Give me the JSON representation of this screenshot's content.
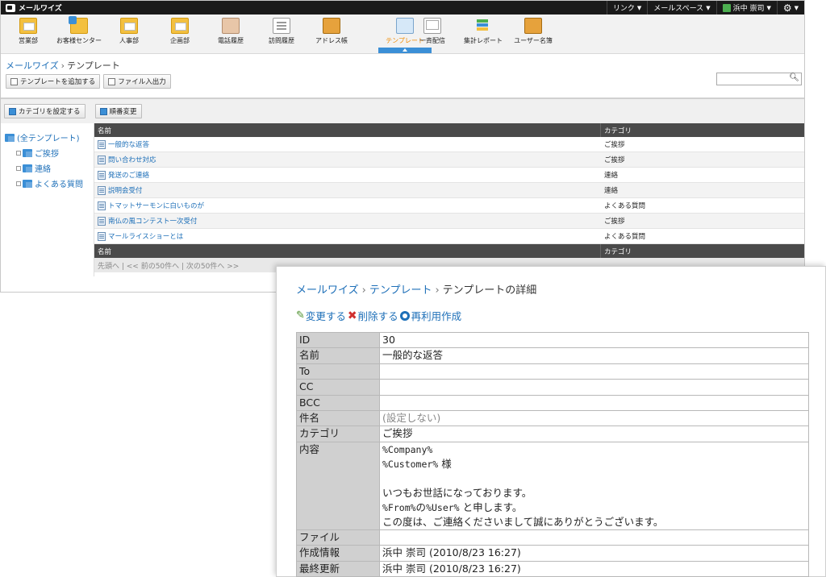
{
  "topbar": {
    "app_name": "メールワイズ",
    "menu": [
      {
        "label": "リンク"
      },
      {
        "label": "メールスペース"
      },
      {
        "label": "浜中 崇司"
      }
    ]
  },
  "apps": [
    {
      "label": "営業部",
      "icon": "folder-icon"
    },
    {
      "label": "お客様センター",
      "icon": "folder-blue-icon"
    },
    {
      "label": "人事部",
      "icon": "folder-icon"
    },
    {
      "label": "企画部",
      "icon": "folder-icon"
    },
    {
      "label": "電話履歴",
      "icon": "phone-log-icon"
    },
    {
      "label": "訪問履歴",
      "icon": "memo-icon"
    },
    {
      "label": "アドレス帳",
      "icon": "address-book-icon"
    },
    {
      "label": "テンプレート",
      "icon": "template-icon"
    },
    {
      "label": "一斉配信",
      "icon": "broadcast-icon"
    },
    {
      "label": "集計レポート",
      "icon": "report-icon"
    },
    {
      "label": "ユーザー名簿",
      "icon": "user-list-icon"
    }
  ],
  "breadcrumb": {
    "root": "メールワイズ",
    "current": "テンプレート"
  },
  "toolbar": {
    "add_template": "テンプレートを追加する",
    "file_io": "ファイル入出力",
    "search_placeholder": ""
  },
  "toolbar2": {
    "set_category": "カテゴリを設定する",
    "reorder": "順番変更"
  },
  "tree": {
    "root": "(全テンプレート)",
    "children": [
      "ご挨拶",
      "連絡",
      "よくある質問"
    ]
  },
  "grid": {
    "header": {
      "name": "名前",
      "category": "カテゴリ"
    },
    "rows": [
      {
        "name": "一般的な返答",
        "category": "ご挨拶"
      },
      {
        "name": "問い合わせ対応",
        "category": "ご挨拶"
      },
      {
        "name": "発送のご連絡",
        "category": "連絡"
      },
      {
        "name": "説明会受付",
        "category": "連絡"
      },
      {
        "name": "トマットサーモンに白いものが",
        "category": "よくある質問"
      },
      {
        "name": "南仏の風コンテスト一次受付",
        "category": "ご挨拶"
      },
      {
        "name": "マールライスショーとは",
        "category": "よくある質問"
      }
    ],
    "pager": "先頭へ | << 前の50件へ | 次の50件へ >>"
  },
  "detail": {
    "breadcrumb": {
      "root": "メールワイズ",
      "mid": "テンプレート",
      "current": "テンプレートの詳細"
    },
    "actions": {
      "edit": "変更する",
      "delete": "削除する",
      "reuse": "再利用作成"
    },
    "fields": {
      "id_label": "ID",
      "id": "30",
      "name_label": "名前",
      "name": "一般的な返答",
      "to_label": "To",
      "to": "",
      "cc_label": "CC",
      "cc": "",
      "bcc_label": "BCC",
      "bcc": "",
      "subject_label": "件名",
      "subject": "(設定しない)",
      "category_label": "カテゴリ",
      "category": "ご挨拶",
      "body_label": "内容",
      "body": [
        "%Company%",
        "%Customer% 様",
        "",
        "いつもお世話になっております。",
        "%From%の%User% と申します。",
        "この度は、ご連絡くださいまして誠にありがとうございます。"
      ],
      "file_label": "ファイル",
      "file": "",
      "created_label": "作成情報",
      "created": "浜中 崇司 (2010/8/23 16:27)",
      "updated_label": "最終更新",
      "updated": "浜中 崇司 (2010/8/23 16:27)"
    }
  },
  "colors": {
    "accent": "#1d6fb8",
    "active_app": "#f08a00",
    "header_bg": "#1a1a1a"
  }
}
